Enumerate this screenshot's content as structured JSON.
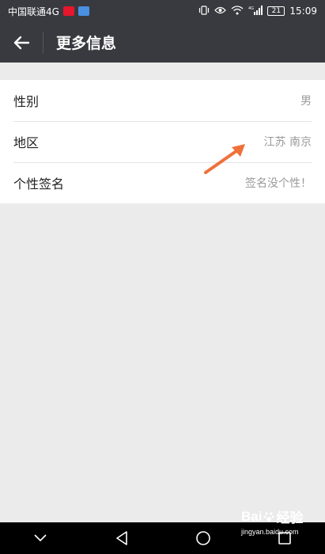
{
  "status_bar": {
    "carrier": "中国联通4G",
    "time": "15:09",
    "battery": "21",
    "network": "4G"
  },
  "header": {
    "title": "更多信息"
  },
  "rows": [
    {
      "label": "性别",
      "value": "男"
    },
    {
      "label": "地区",
      "value": "江苏 南京"
    },
    {
      "label": "个性签名",
      "value": "签名没个性！"
    }
  ],
  "watermark": {
    "brand_a": "Bai",
    "brand_b": "经验",
    "url": "jingyan.baidu.com"
  },
  "colors": {
    "header_bg": "#393a3f",
    "page_bg": "#ebebeb",
    "arrow": "#f0703a"
  }
}
